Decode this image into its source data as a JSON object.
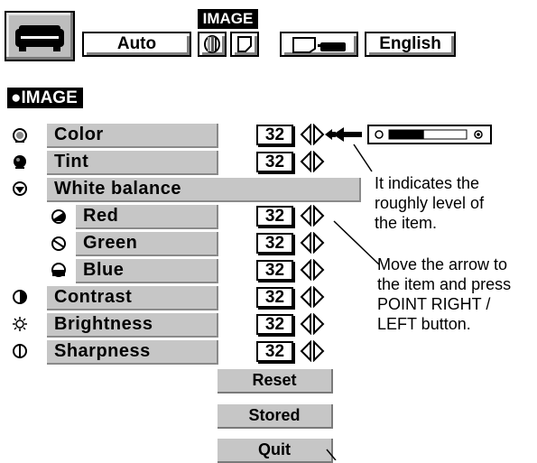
{
  "toolbar": {
    "title": "IMAGE",
    "mode_label": "Auto",
    "language_label": "English"
  },
  "section": {
    "title": "●IMAGE"
  },
  "rows": [
    {
      "label": "Color",
      "value": "32",
      "icon": "color-icon"
    },
    {
      "label": "Tint",
      "value": "32",
      "icon": "tint-icon"
    },
    {
      "label": "White balance",
      "icon": "white-balance-icon"
    },
    {
      "label": "Red",
      "value": "32",
      "icon": "red-icon"
    },
    {
      "label": "Green",
      "value": "32",
      "icon": "green-icon"
    },
    {
      "label": "Blue",
      "value": "32",
      "icon": "blue-icon"
    },
    {
      "label": "Contrast",
      "value": "32",
      "icon": "contrast-icon"
    },
    {
      "label": "Brightness",
      "value": "32",
      "icon": "brightness-icon"
    },
    {
      "label": "Sharpness",
      "value": "32",
      "icon": "sharpness-icon"
    }
  ],
  "buttons": {
    "reset": "Reset",
    "stored": "Stored",
    "quit": "Quit"
  },
  "level_indicator": {
    "level": 0.45
  },
  "notes": {
    "level": [
      "It indicates the",
      "roughly level of",
      "the item."
    ],
    "arrow": [
      "Move the arrow to",
      "the item and press",
      "POINT RIGHT /",
      "LEFT button."
    ]
  }
}
